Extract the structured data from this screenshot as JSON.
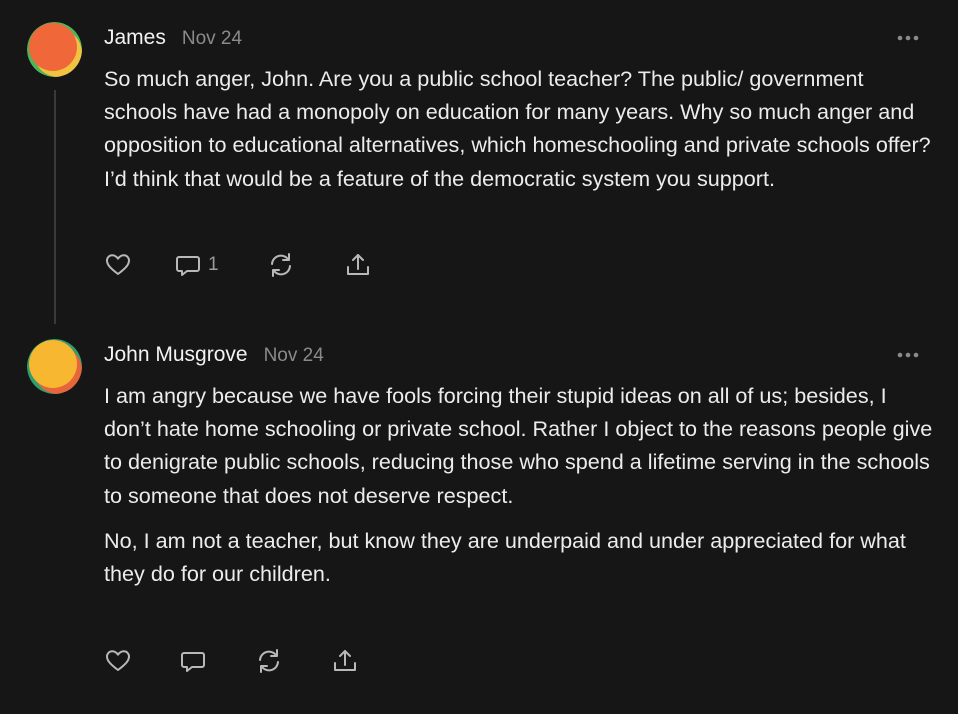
{
  "comments": [
    {
      "author": "James",
      "date": "Nov 24",
      "paragraphs": [
        "So much anger, John. Are you a public school teacher? The public/ government schools have had a monopoly on education for many years. Why so much anger and opposition to educational alternatives, which homeschooling and private schools offer? I’d think that would be a feature of the democratic system you support."
      ],
      "reply_count": "1",
      "avatar_colors": [
        "#f0683a",
        "#4fb35a",
        "#f2c341"
      ]
    },
    {
      "author": "John Musgrove",
      "date": "Nov 24",
      "paragraphs": [
        "I am angry because we have fools forcing their stupid ideas on all of us; besides, I don’t hate home schooling or private school. Rather I object to the reasons people give to denigrate public schools, reducing those who spend a lifetime serving in the schools to someone that does not deserve respect.",
        "No, I am not a teacher, but know they are underpaid and under appreciated for what they do for our children."
      ],
      "reply_count": "",
      "avatar_colors": [
        "#f7b731",
        "#2f9e6e",
        "#e8643a"
      ]
    }
  ],
  "icons": {
    "like": "heart-icon",
    "reply": "comment-bubble-icon",
    "restack": "restack-icon",
    "share": "share-upload-icon",
    "more": "ellipsis-icon"
  },
  "colors": {
    "background": "#161616",
    "text": "#ececec",
    "muted": "#8a8a8a",
    "icon": "#b8b8b8",
    "thread_line": "#3a3a3a"
  }
}
